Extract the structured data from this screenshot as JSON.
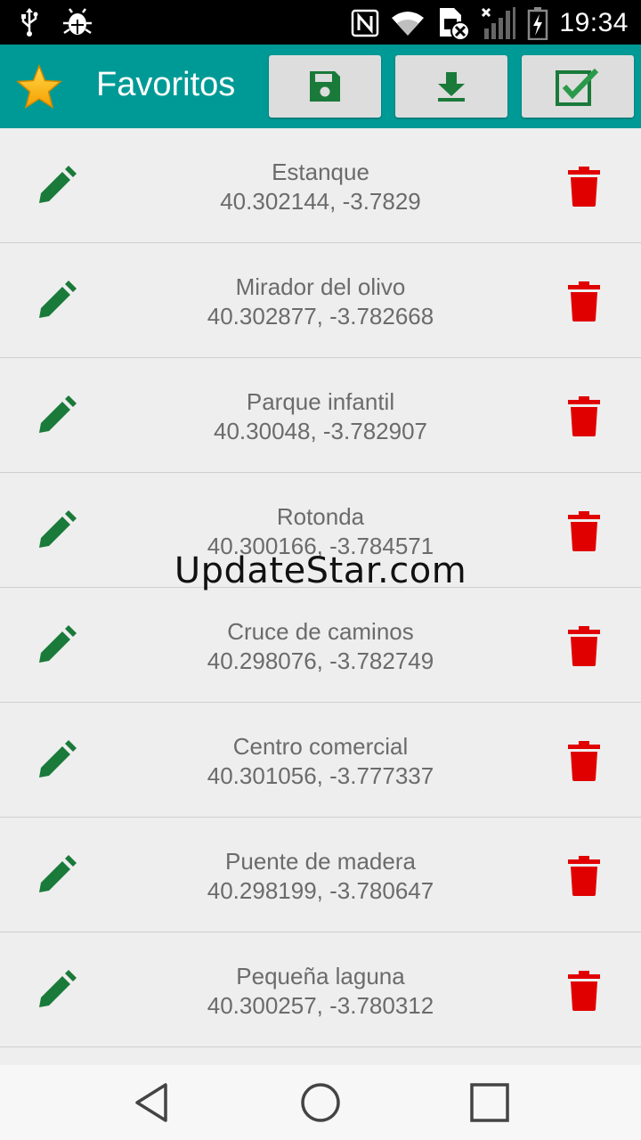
{
  "status_bar": {
    "time": "19:34",
    "icons": [
      "usb-icon",
      "debug-icon",
      "nfc-icon",
      "wifi-icon",
      "sim-error-icon",
      "signal-icon",
      "battery-charging-icon"
    ]
  },
  "app_bar": {
    "title": "Favoritos",
    "buttons": [
      "save-icon",
      "download-icon",
      "select-all-icon"
    ],
    "accent": "#009a96"
  },
  "favorites": [
    {
      "name": "Estanque",
      "coords": "40.302144, -3.7829"
    },
    {
      "name": "Mirador del olivo",
      "coords": "40.302877, -3.782668"
    },
    {
      "name": "Parque infantil",
      "coords": "40.30048, -3.782907"
    },
    {
      "name": "Rotonda",
      "coords": "40.300166, -3.784571"
    },
    {
      "name": "Cruce de caminos",
      "coords": "40.298076, -3.782749"
    },
    {
      "name": "Centro comercial",
      "coords": "40.301056, -3.777337"
    },
    {
      "name": "Puente de madera",
      "coords": "40.298199, -3.780647"
    },
    {
      "name": "Pequeña laguna",
      "coords": "40.300257, -3.780312"
    }
  ],
  "watermark": "UpdateStar.com",
  "colors": {
    "edit": "#1a7a3a",
    "delete": "#e00000",
    "bar": "#009a96"
  },
  "nav": [
    "back-icon",
    "home-icon",
    "recents-icon"
  ]
}
